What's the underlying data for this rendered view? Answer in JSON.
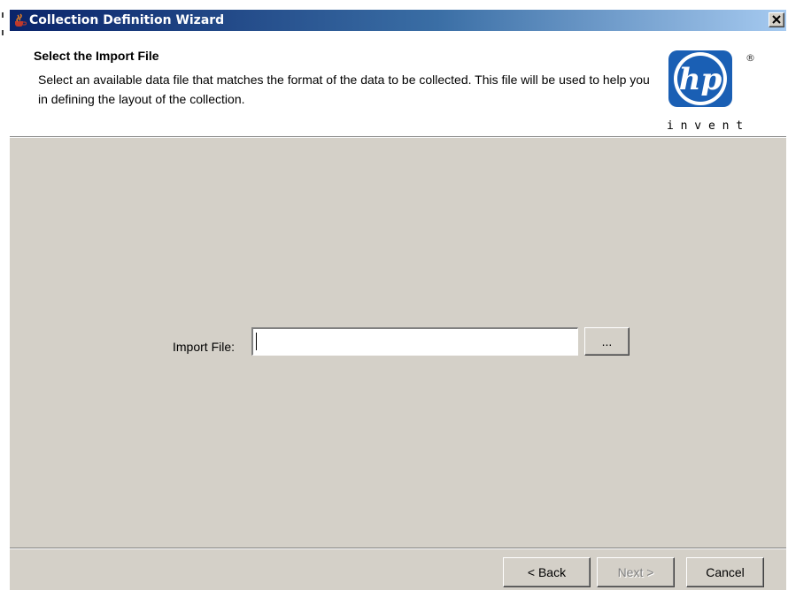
{
  "window": {
    "title": "Collection Definition Wizard",
    "app_icon": "java-cup-icon",
    "close_icon": "close-icon"
  },
  "header": {
    "title": "Select the Import File",
    "description": "Select an available data file that matches the format of the data to be collected. This file will be used to help you in defining the layout of the collection.",
    "logo": {
      "brand": "hp",
      "registered_mark": "®",
      "tagline": "i n v e n t"
    }
  },
  "form": {
    "import_label": "Import File:",
    "import_value": "",
    "browse_label": "..."
  },
  "footer": {
    "back_label": "< Back",
    "next_label": "Next >",
    "next_enabled": false,
    "cancel_label": "Cancel"
  },
  "colors": {
    "dialog_face": "#d4d0c8",
    "title_gradient_start": "#0a246a",
    "title_gradient_end": "#a6caf0",
    "logo_blue": "#1a5fb4"
  }
}
